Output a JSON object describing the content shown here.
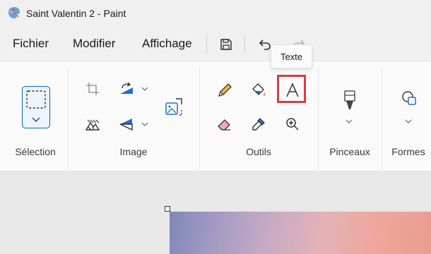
{
  "window": {
    "title": "Saint Valentin 2 - Paint"
  },
  "menu": {
    "file": "Fichier",
    "edit": "Modifier",
    "view": "Affichage"
  },
  "tooltip": {
    "text": "Texte"
  },
  "ribbon": {
    "selection_label": "Sélection",
    "image_label": "Image",
    "tools_label": "Outils",
    "brushes_label": "Pinceaux",
    "shapes_label": "Formes"
  },
  "colors": {
    "highlight": "#e03a3a",
    "accent": "#0067c0"
  }
}
